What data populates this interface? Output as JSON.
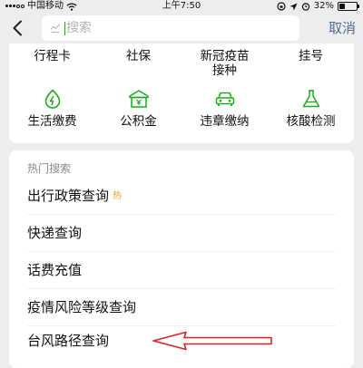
{
  "status_bar": {
    "carrier": "中国移动",
    "time": "上午7:50",
    "battery_percent": "32%",
    "battery_level": 0.32
  },
  "search": {
    "back_icon": "chevron-left-icon",
    "search_icon": "search-icon",
    "placeholder": "搜索",
    "value": "",
    "cancel_label": "取消",
    "cancel_color": "#576b95"
  },
  "services": {
    "top_row": [
      {
        "label": "行程卡"
      },
      {
        "label": "社保"
      },
      {
        "label": "新冠疫苗接种",
        "line1": "新冠疫苗",
        "line2": "接种"
      },
      {
        "label": "挂号"
      }
    ],
    "bottom_row": [
      {
        "label": "生活缴费",
        "icon": "lightning-icon"
      },
      {
        "label": "公积金",
        "icon": "building-icon"
      },
      {
        "label": "违章缴纳",
        "icon": "car-icon"
      },
      {
        "label": "核酸检测",
        "icon": "flask-icon"
      }
    ],
    "icon_color": "#1aad19"
  },
  "hot_search": {
    "title": "热门搜索",
    "items": [
      {
        "label": "出行政策查询",
        "badge": "热"
      },
      {
        "label": "快递查询"
      },
      {
        "label": "话费充值"
      },
      {
        "label": "疫情风险等级查询"
      },
      {
        "label": "台风路径查询"
      }
    ],
    "badge_color": "#f0a020"
  },
  "annotation": {
    "icon": "red-arrow-icon",
    "color": "#e02020"
  }
}
